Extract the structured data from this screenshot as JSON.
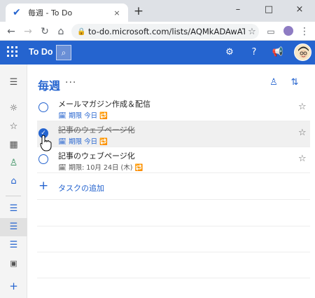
{
  "browser": {
    "tab_title": "毎週 - To Do",
    "tab_close": "×",
    "new_tab": "+",
    "url": "to-do.microsoft.com/lists/AQMkADAwATM3Z...",
    "minimize": "–",
    "maximize": "□",
    "close": "×"
  },
  "app": {
    "brand": "To Do",
    "accent_color": "#2564cf"
  },
  "list": {
    "title": "毎週",
    "more": "···",
    "tasks": [
      {
        "name": "メールマガジン作成＆配信",
        "meta": "🗓 期限 今日 🔁",
        "completed": false,
        "selected": false
      },
      {
        "name": "記事のウェブページ化",
        "meta": "🗓 期限 今日 🔁",
        "completed": true,
        "selected": true
      },
      {
        "name": "記事のウェブページ化",
        "meta": "🗓 期限: 10月 24日 (木) 🔁",
        "completed": false,
        "selected": false
      }
    ],
    "add_task_label": "タスクの追加",
    "add_task_icon": "+"
  },
  "icons": {
    "star": "☆",
    "check": "✓"
  }
}
